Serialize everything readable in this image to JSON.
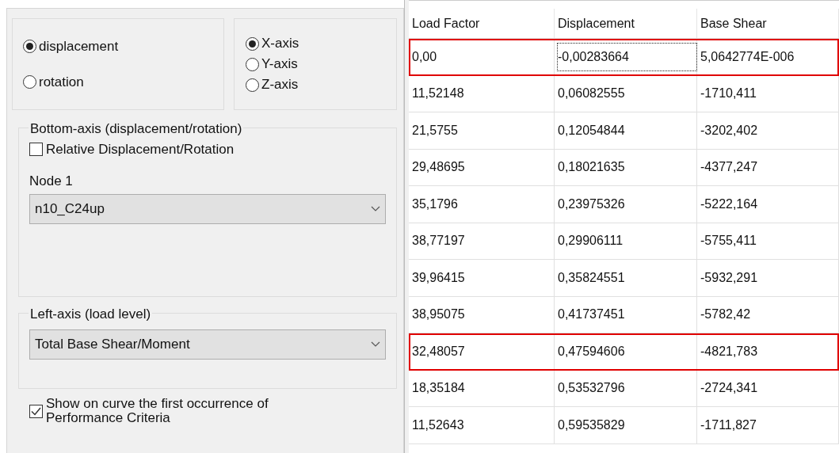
{
  "quantity_options": [
    {
      "label": "displacement",
      "selected": true
    },
    {
      "label": "rotation",
      "selected": false
    }
  ],
  "axis_options": [
    {
      "label": "X-axis",
      "selected": true
    },
    {
      "label": "Y-axis",
      "selected": false
    },
    {
      "label": "Z-axis",
      "selected": false
    }
  ],
  "bottom_axis": {
    "title": "Bottom-axis (displacement/rotation)",
    "relative": {
      "label": "Relative Displacement/Rotation",
      "checked": false
    },
    "node_label": "Node 1",
    "node_value": "n10_C24up"
  },
  "left_axis": {
    "title": "Left-axis (load level)",
    "value": "Total Base Shear/Moment"
  },
  "show_criteria": {
    "label": "Show on curve the first occurrence of Performance Criteria",
    "checked": true
  },
  "table": {
    "columns": [
      "Load Factor",
      "Displacement",
      "Base Shear"
    ],
    "rows": [
      {
        "highlighted": true,
        "cells": [
          {
            "text": "0,00",
            "focused": false
          },
          {
            "text": "-0,00283664",
            "focused": true
          },
          {
            "text": "5,0642774E-006",
            "focused": false
          }
        ]
      },
      {
        "highlighted": false,
        "cells": [
          {
            "text": "11,52148",
            "focused": false
          },
          {
            "text": "0,06082555",
            "focused": false
          },
          {
            "text": "-1710,411",
            "focused": false
          }
        ]
      },
      {
        "highlighted": false,
        "cells": [
          {
            "text": "21,5755",
            "focused": false
          },
          {
            "text": "0,12054844",
            "focused": false
          },
          {
            "text": "-3202,402",
            "focused": false
          }
        ]
      },
      {
        "highlighted": false,
        "cells": [
          {
            "text": "29,48695",
            "focused": false
          },
          {
            "text": "0,18021635",
            "focused": false
          },
          {
            "text": "-4377,247",
            "focused": false
          }
        ]
      },
      {
        "highlighted": false,
        "cells": [
          {
            "text": "35,1796",
            "focused": false
          },
          {
            "text": "0,23975326",
            "focused": false
          },
          {
            "text": "-5222,164",
            "focused": false
          }
        ]
      },
      {
        "highlighted": false,
        "cells": [
          {
            "text": "38,77197",
            "focused": false
          },
          {
            "text": "0,29906111",
            "focused": false
          },
          {
            "text": "-5755,411",
            "focused": false
          }
        ]
      },
      {
        "highlighted": false,
        "cells": [
          {
            "text": "39,96415",
            "focused": false
          },
          {
            "text": "0,35824551",
            "focused": false
          },
          {
            "text": "-5932,291",
            "focused": false
          }
        ]
      },
      {
        "highlighted": false,
        "cells": [
          {
            "text": "38,95075",
            "focused": false
          },
          {
            "text": "0,41737451",
            "focused": false
          },
          {
            "text": "-5782,42",
            "focused": false
          }
        ]
      },
      {
        "highlighted": true,
        "cells": [
          {
            "text": "32,48057",
            "focused": false
          },
          {
            "text": "0,47594606",
            "focused": false
          },
          {
            "text": "-4821,783",
            "focused": false
          }
        ]
      },
      {
        "highlighted": false,
        "cells": [
          {
            "text": "18,35184",
            "focused": false
          },
          {
            "text": "0,53532796",
            "focused": false
          },
          {
            "text": "-2724,341",
            "focused": false
          }
        ]
      },
      {
        "highlighted": false,
        "cells": [
          {
            "text": "11,52643",
            "focused": false
          },
          {
            "text": "0,59535829",
            "focused": false
          },
          {
            "text": "-1711,827",
            "focused": false
          }
        ]
      }
    ]
  }
}
